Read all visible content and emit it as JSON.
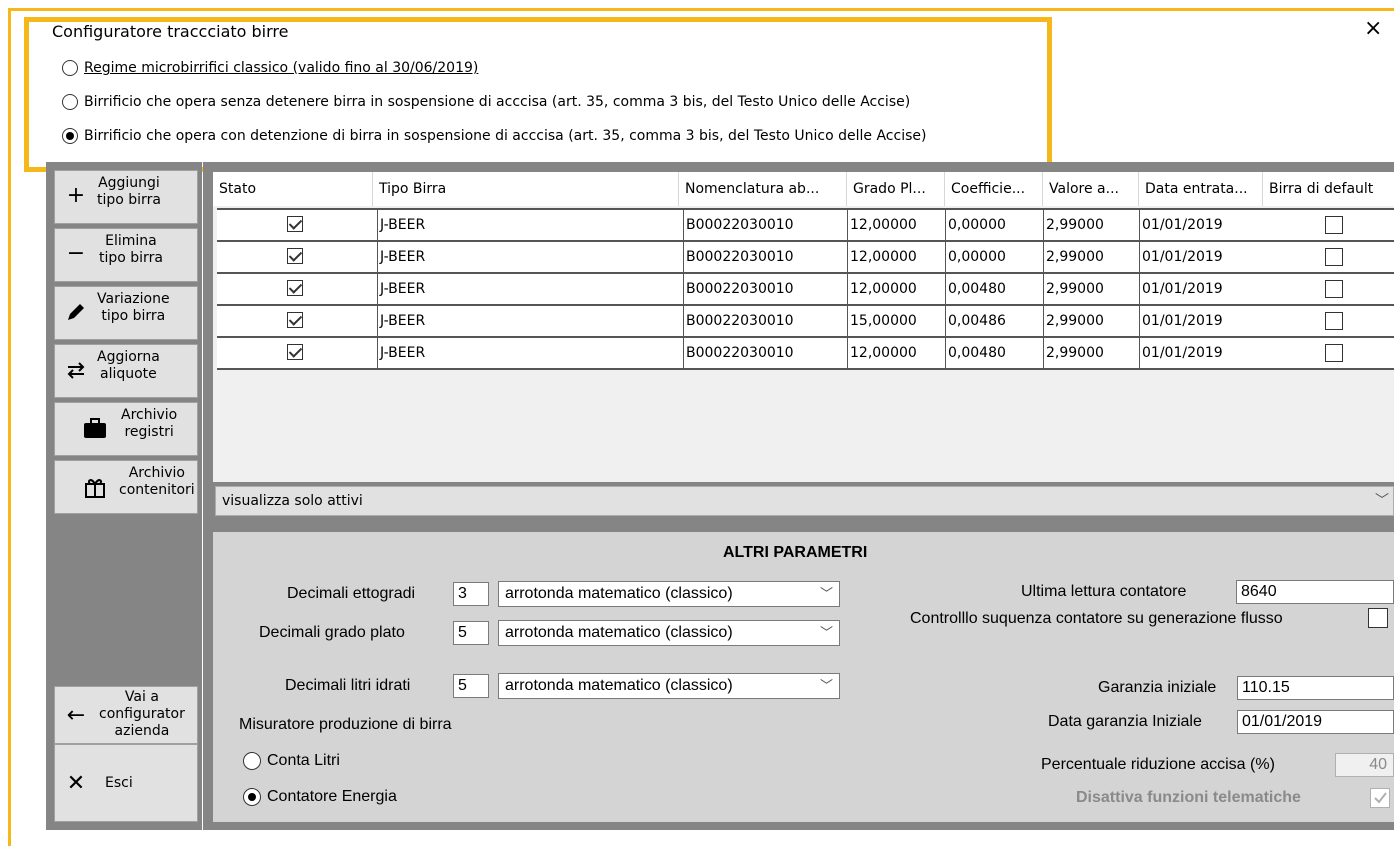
{
  "window": {
    "title": "Configuratore traccciato birre",
    "close_glyph": "×"
  },
  "regimes": [
    {
      "label": "Regime microbirrifici classico (valido fino al 30/06/2019)",
      "selected": false
    },
    {
      "label": "Birrificio che opera senza detenere birra in sospensione di acccisa (art. 35, comma 3 bis, del Testo Unico delle Accise)",
      "selected": false
    },
    {
      "label": "Birrificio che opera con detenzione di birra in sospensione di acccisa (art. 35, comma 3 bis, del Testo Unico delle Accise)",
      "selected": true
    }
  ],
  "sidebar": {
    "add": {
      "line1": "Aggiungi",
      "line2": "tipo birra",
      "icon": "plus-icon"
    },
    "remove": {
      "line1": "Elimina",
      "line2": "tipo birra",
      "icon": "minus-icon"
    },
    "edit": {
      "line1": "Variazione",
      "line2": "tipo birra",
      "icon": "pencil-icon"
    },
    "update": {
      "line1": "Aggiorna",
      "line2": "aliquote",
      "icon": "swap-arrows-icon"
    },
    "registers": {
      "line1": "Archivio",
      "line2": "registri",
      "icon": "briefcase-icon"
    },
    "containers": {
      "line1": "Archivio",
      "line2": "contenitori",
      "icon": "gift-icon"
    },
    "goto": {
      "line1": "Vai a",
      "line2": "configurator",
      "line3": "azienda",
      "icon": "arrow-left-icon"
    },
    "exit": {
      "label": "Esci",
      "icon": "close-icon"
    }
  },
  "table": {
    "columns": [
      "Stato",
      "Tipo Birra",
      "Nomenclatura ab...",
      "Grado Pl...",
      "Coefficie...",
      "Valore a...",
      "Data entrata...",
      "Birra di default"
    ],
    "rows": [
      {
        "stato": true,
        "tipo": "J-BEER",
        "nomenclatura": "B00022030010",
        "grado": "12,00000",
        "coeff": "0,00000",
        "valore": "2,99000",
        "data": "01/01/2019",
        "default": false
      },
      {
        "stato": true,
        "tipo": "J-BEER",
        "nomenclatura": "B00022030010",
        "grado": "12,00000",
        "coeff": "0,00000",
        "valore": "2,99000",
        "data": "01/01/2019",
        "default": false
      },
      {
        "stato": true,
        "tipo": "J-BEER",
        "nomenclatura": "B00022030010",
        "grado": "12,00000",
        "coeff": "0,00480",
        "valore": "2,99000",
        "data": "01/01/2019",
        "default": false
      },
      {
        "stato": true,
        "tipo": "J-BEER",
        "nomenclatura": "B00022030010",
        "grado": "15,00000",
        "coeff": "0,00486",
        "valore": "2,99000",
        "data": "01/01/2019",
        "default": false
      },
      {
        "stato": true,
        "tipo": "J-BEER",
        "nomenclatura": "B00022030010",
        "grado": "12,00000",
        "coeff": "0,00480",
        "valore": "2,99000",
        "data": "01/01/2019",
        "default": false
      }
    ],
    "filter": "visualizza solo attivi"
  },
  "params": {
    "title": "ALTRI PARAMETRI",
    "decimali_ettogradi": {
      "label": "Decimali ettogradi",
      "value": "3",
      "mode": "arrotonda matematico (classico)"
    },
    "decimali_grado_plato": {
      "label": "Decimali grado plato",
      "value": "5",
      "mode": "arrotonda matematico (classico)"
    },
    "decimali_litri_idrati": {
      "label": "Decimali litri idrati",
      "value": "5",
      "mode": "arrotonda matematico (classico)"
    },
    "misuratore_label": "Misuratore produzione di birra",
    "misuratore_options": [
      {
        "label": "Conta Litri",
        "selected": false
      },
      {
        "label": "Contatore Energia",
        "selected": true
      }
    ],
    "ultima_lettura": {
      "label": "Ultima lettura contatore",
      "value": "8640"
    },
    "controllo_sequenza": {
      "label": "Controlllo suquenza contatore su generazione flusso",
      "checked": false
    },
    "garanzia_iniziale": {
      "label": "Garanzia iniziale",
      "value": "110.15"
    },
    "data_garanzia": {
      "label": "Data garanzia Iniziale",
      "value": "01/01/2019"
    },
    "percentuale": {
      "label": "Percentuale riduzione accisa (%)",
      "value": "40"
    },
    "disattiva": {
      "label": "Disattiva funzioni telematiche",
      "checked": true
    }
  },
  "colors": {
    "highlight": "#f5b81b",
    "panel_dark": "#858585",
    "panel_light": "#d4d4d4"
  }
}
